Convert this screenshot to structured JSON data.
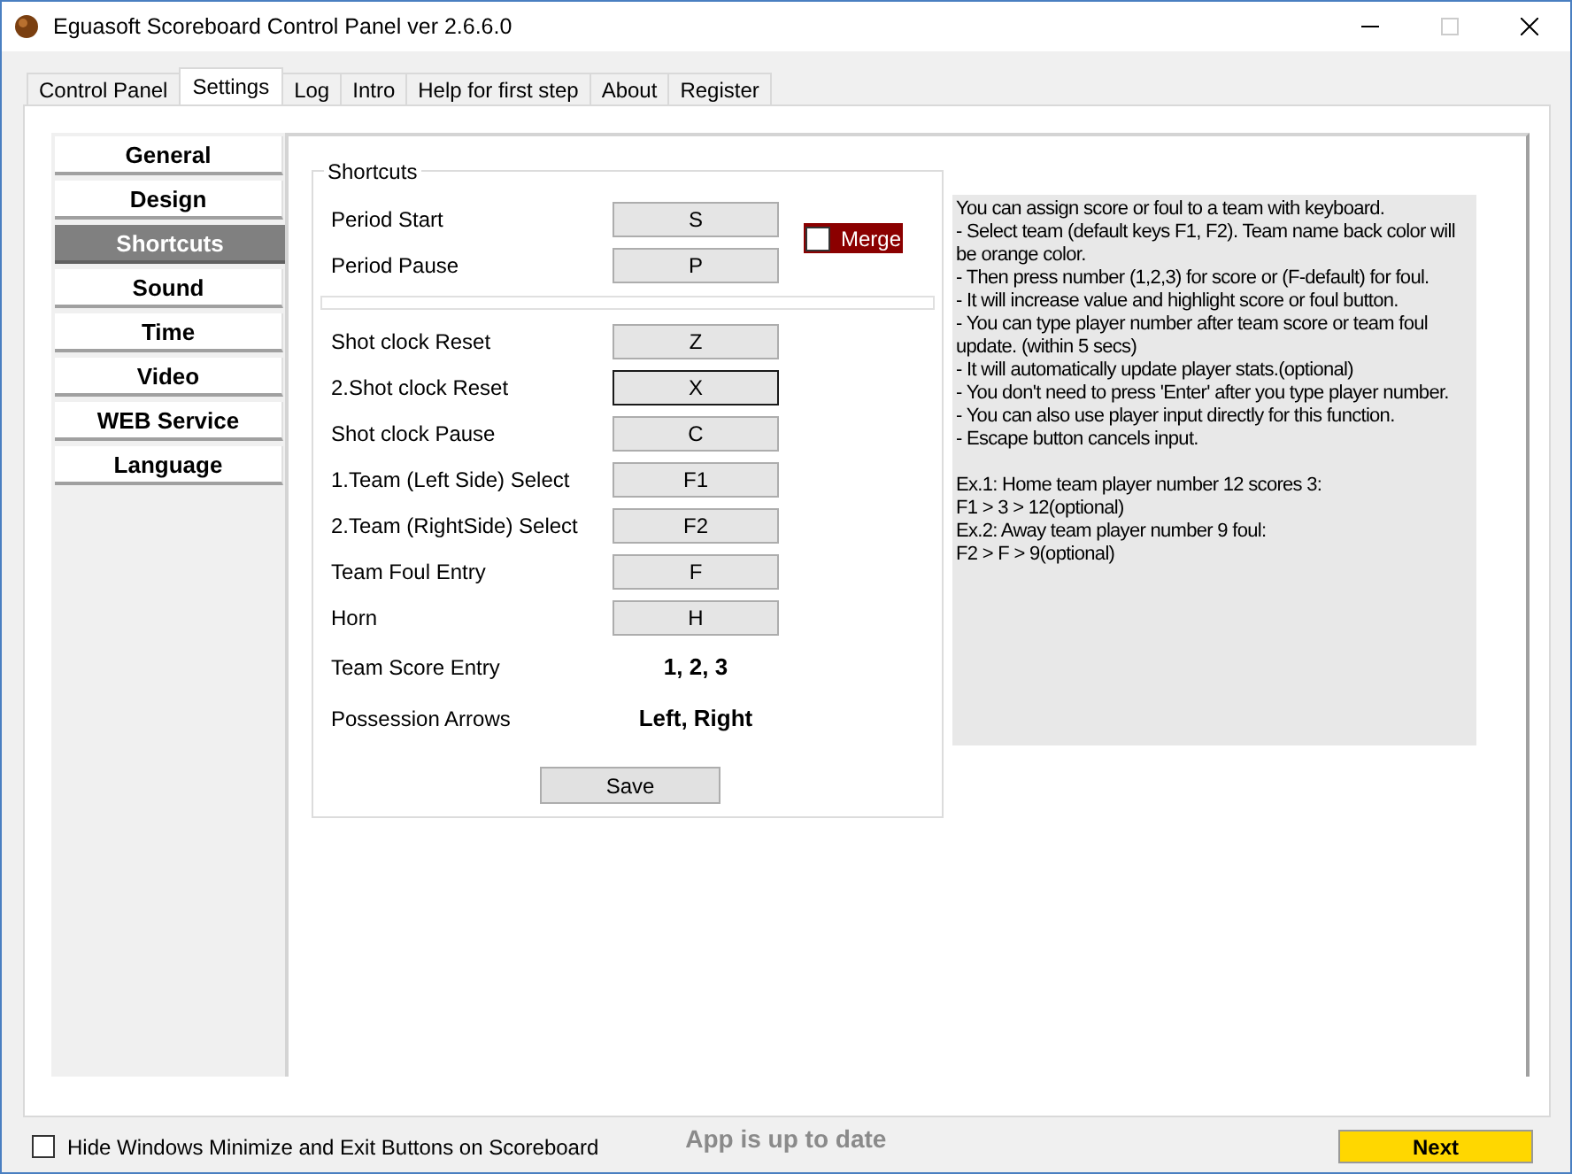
{
  "window": {
    "title": "Eguasoft Scoreboard Control Panel ver 2.6.6.0"
  },
  "tabs": [
    {
      "label": "Control Panel",
      "selected": false
    },
    {
      "label": "Settings",
      "selected": true
    },
    {
      "label": "Log",
      "selected": false
    },
    {
      "label": "Intro",
      "selected": false
    },
    {
      "label": "Help for first step",
      "selected": false
    },
    {
      "label": "About",
      "selected": false
    },
    {
      "label": "Register",
      "selected": false
    }
  ],
  "sidebar": {
    "items": [
      {
        "label": "General",
        "selected": false
      },
      {
        "label": "Design",
        "selected": false
      },
      {
        "label": "Shortcuts",
        "selected": true
      },
      {
        "label": "Sound",
        "selected": false
      },
      {
        "label": "Time",
        "selected": false
      },
      {
        "label": "Video",
        "selected": false
      },
      {
        "label": "WEB Service",
        "selected": false
      },
      {
        "label": "Language",
        "selected": false
      }
    ]
  },
  "shortcuts": {
    "title": "Shortcuts",
    "merge": {
      "label": "Merge",
      "checked": false
    },
    "rows": [
      {
        "kind": "key",
        "label": "Period Start",
        "value": "S",
        "focused": false
      },
      {
        "kind": "key",
        "label": "Period Pause",
        "value": "P",
        "focused": false
      },
      {
        "kind": "divider"
      },
      {
        "kind": "key",
        "label": "Shot clock Reset",
        "value": "Z",
        "focused": false
      },
      {
        "kind": "key",
        "label": "2.Shot clock Reset",
        "value": "X",
        "focused": true
      },
      {
        "kind": "key",
        "label": "Shot clock Pause",
        "value": "C",
        "focused": false
      },
      {
        "kind": "key",
        "label": "1.Team (Left Side) Select",
        "value": "F1",
        "focused": false
      },
      {
        "kind": "key",
        "label": "2.Team (RightSide) Select",
        "value": "F2",
        "focused": false
      },
      {
        "kind": "key",
        "label": "Team Foul Entry",
        "value": "F",
        "focused": false
      },
      {
        "kind": "key",
        "label": "Horn",
        "value": "H",
        "focused": false
      },
      {
        "kind": "text",
        "label": "Team Score Entry",
        "value": "1, 2, 3"
      },
      {
        "kind": "text",
        "label": "Possession Arrows",
        "value": "Left, Right"
      }
    ],
    "save": "Save"
  },
  "help": {
    "instructions": [
      "You can assign score or foul to a team with keyboard.",
      "- Select team (default keys F1, F2). Team name back color will be orange color.",
      "- Then press number (1,2,3) for score or (F-default) for foul.",
      "- It will increase value and highlight score or foul button.",
      "- You can type player number after team score or team foul update. (within 5 secs)",
      "- It will automatically update player stats.(optional)",
      "- You don't need to press 'Enter' after you type player number.",
      "- You can also use player input directly for this function.",
      "- Escape button cancels input."
    ],
    "examples": [
      "Ex.1: Home team player number 12 scores 3:",
      "F1 > 3 > 12(optional)",
      "Ex.2: Away team player number 9 foul:",
      "F2 > F > 9(optional)"
    ]
  },
  "footer": {
    "hide_buttons": {
      "label": "Hide Windows Minimize and Exit Buttons on Scoreboard",
      "checked": false
    },
    "status": "App is up to date",
    "next": "Next"
  }
}
